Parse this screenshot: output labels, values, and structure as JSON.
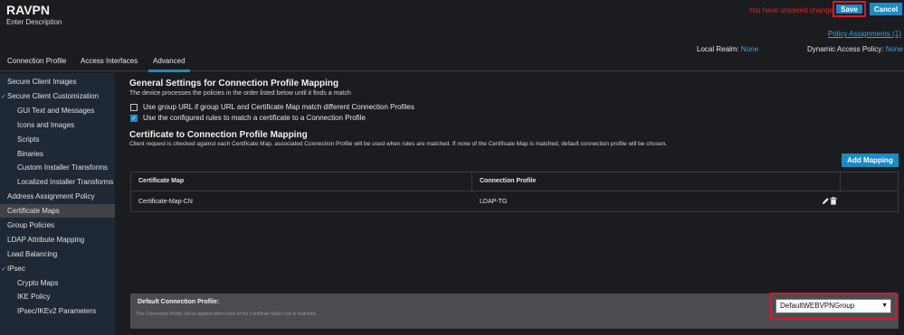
{
  "page": {
    "title": "RAVPN",
    "description": "Enter Description"
  },
  "actions": {
    "unsaved": "You have unsaved changes",
    "save_label": "Save",
    "cancel_label": "Cancel",
    "policy_link": "Policy Assignments (1)"
  },
  "realm": {
    "label": "Local Realm: ",
    "value": "None"
  },
  "dap": {
    "label": "Dynamic Access Policy: ",
    "value": "None"
  },
  "tabs": [
    {
      "label": "Connection Profile"
    },
    {
      "label": "Access Interfaces"
    },
    {
      "label": "Advanced",
      "active": true
    }
  ],
  "sidebar": {
    "items": [
      {
        "label": "Secure Client Images"
      },
      {
        "label": "Secure Client Customization",
        "expandable": true
      },
      {
        "label": "GUI Text and Messages"
      },
      {
        "label": "Icons and Images"
      },
      {
        "label": "Scripts"
      },
      {
        "label": "Binaries"
      },
      {
        "label": "Custom Installer Transforms"
      },
      {
        "label": "Localized Installer Transforms"
      },
      {
        "label": "Address Assignment Policy"
      },
      {
        "label": "Certificate Maps",
        "active": true
      },
      {
        "label": "Group Policies"
      },
      {
        "label": "LDAP Attribute Mapping"
      },
      {
        "label": "Load Balancing"
      },
      {
        "label": "IPsec",
        "expandable": true
      },
      {
        "label": "Crypto Maps"
      },
      {
        "label": "IKE Policy"
      },
      {
        "label": "IPsec/IKEv2 Parameters"
      }
    ]
  },
  "general": {
    "heading": "General Settings for Connection Profile Mapping",
    "subtext": "The device processes the policies in the order listed below until it finds a match",
    "options": [
      {
        "label": "Use group URL if group URL and Certificate Map match different Connection Profiles",
        "checked": false
      },
      {
        "label": "Use the configured rules to match a certificate to a Connection Profile",
        "checked": true
      }
    ]
  },
  "mapping": {
    "heading": "Certificate to Connection Profile Mapping",
    "subtext": "Client request is checked against each Certificate Map, associated Connection Profile will be used when rules are matched. If none of the Certificate Map is matched, default connection profile will be chosen.",
    "add_label": "Add Mapping",
    "columns": [
      "Certificate Map",
      "Connection Profile"
    ],
    "rows": [
      {
        "certificate_map": "Certificate-Map-CN",
        "connection_profile": "LDAP-TG"
      }
    ]
  },
  "default_profile": {
    "label": "Default Connection Profile:",
    "help": "This Connection Profile will be applied when none of the Certificate Map's rule is matched.",
    "selected": "DefaultWEBVPNGroup"
  },
  "colors": {
    "accent": "#1c8bc4",
    "highlight_border": "#d7192c",
    "link": "#3ba5dc",
    "warning_text": "#e0241e"
  },
  "icons": {
    "edit": "pencil-icon",
    "delete": "trash-icon",
    "dropdown": "caret-down-icon",
    "expand": "chevron-down-icon",
    "check": "check-icon"
  }
}
